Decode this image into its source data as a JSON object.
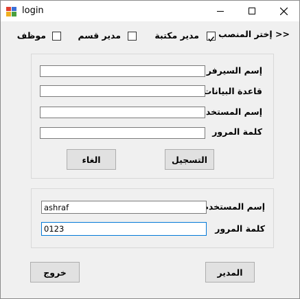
{
  "window": {
    "title": "login"
  },
  "roles": {
    "prompt": "إختر المنصب >>",
    "items": [
      {
        "label": "مدير مكتبة",
        "checked": true
      },
      {
        "label": "مدير قسم",
        "checked": false
      },
      {
        "label": "موظف",
        "checked": false
      }
    ]
  },
  "register": {
    "server_label": "إسم السيرفر",
    "server_value": "",
    "database_label": "قاعدة البيانات",
    "database_value": "",
    "username_label": "إسم المستخدم",
    "username_value": "",
    "password_label": "كلمة المرور",
    "password_value": "",
    "register_button": "التسجيل",
    "cancel_button": "الغاء"
  },
  "login": {
    "username_label": "إسم المستخدم",
    "username_value": "ashraf",
    "password_label": "كلمة المرور",
    "password_value": "0123"
  },
  "footer": {
    "exit_button": "خروج",
    "admin_button": "المدير"
  }
}
